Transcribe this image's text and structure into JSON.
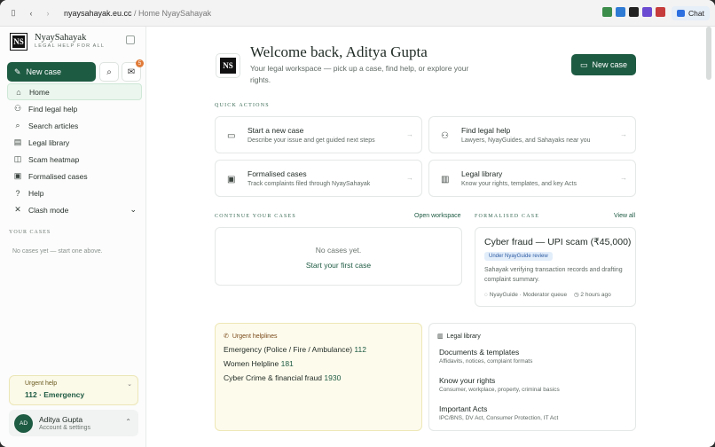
{
  "browser": {
    "url_host": "nyaysahayak.eu.cc",
    "url_path": " / Home NyaySahayak",
    "chat_label": "Chat"
  },
  "sidebar": {
    "brand": "NyaySahayak",
    "tagline": "LEGAL HELP FOR ALL",
    "logo_text": "NS",
    "new_case": "New case",
    "inbox_badge": "5",
    "items": [
      {
        "label": "Home",
        "icon": "home-icon",
        "glyph": "⌂"
      },
      {
        "label": "Find legal help",
        "icon": "person-icon",
        "glyph": "⚇"
      },
      {
        "label": "Search articles",
        "icon": "search-icon",
        "glyph": "⌕"
      },
      {
        "label": "Legal library",
        "icon": "book-icon",
        "glyph": "▤"
      },
      {
        "label": "Scam heatmap",
        "icon": "map-icon",
        "glyph": "◫"
      },
      {
        "label": "Formalised cases",
        "icon": "archive-icon",
        "glyph": "▣"
      },
      {
        "label": "Help",
        "icon": "help-icon",
        "glyph": "?"
      },
      {
        "label": "Clash mode",
        "icon": "swords-icon",
        "glyph": "✕"
      }
    ],
    "your_cases_heading": "YOUR CASES",
    "your_cases_empty": "No cases yet — start one above.",
    "urgent_title": "Urgent help",
    "urgent_value": "112 · Emergency",
    "user_initials": "AD",
    "user_name": "Aditya Gupta",
    "user_sub": "Account & settings"
  },
  "header": {
    "title": "Welcome back, Aditya Gupta",
    "subtitle": "Your legal workspace — pick up a case, find help, or explore your rights.",
    "new_case": "New case"
  },
  "quick_actions": {
    "heading": "QUICK ACTIONS",
    "items": [
      {
        "title": "Start a new case",
        "desc": "Describe your issue and get guided next steps",
        "icon": "chat-icon",
        "glyph": "▭"
      },
      {
        "title": "Find legal help",
        "desc": "Lawyers, NyayGuides, and Sahayaks near you",
        "icon": "people-icon",
        "glyph": "⚇"
      },
      {
        "title": "Formalised cases",
        "desc": "Track complaints filed through NyaySahayak",
        "icon": "briefcase-icon",
        "glyph": "▣"
      },
      {
        "title": "Legal library",
        "desc": "Know your rights, templates, and key Acts",
        "icon": "book-icon",
        "glyph": "▥"
      }
    ]
  },
  "continue": {
    "heading": "CONTINUE YOUR CASES",
    "link": "Open workspace",
    "empty": "No cases yet.",
    "cta": "Start your first case"
  },
  "formalised": {
    "heading": "FORMALISED CASE",
    "link": "View all",
    "title": "Cyber fraud — UPI scam (₹45,000)",
    "badge": "Under NyayGuide review",
    "desc": "Sahayak verifying transaction records and drafting complaint summary.",
    "meta_left": "NyayGuide · Moderator queue",
    "meta_right": "2 hours ago"
  },
  "helplines": {
    "heading": "Urgent helplines",
    "rows": [
      {
        "label": "Emergency (Police / Fire / Ambulance)",
        "number": "112"
      },
      {
        "label": "Women Helpline",
        "number": "181"
      },
      {
        "label": "Cyber Crime & financial fraud",
        "number": "1930"
      }
    ]
  },
  "library": {
    "heading": "Legal library",
    "items": [
      {
        "title": "Documents & templates",
        "desc": "Affidavits, notices, complaint formats"
      },
      {
        "title": "Know your rights",
        "desc": "Consumer, workplace, property, criminal basics"
      },
      {
        "title": "Important Acts",
        "desc": "IPC/BNS, DV Act, Consumer Protection, IT Act"
      }
    ]
  }
}
